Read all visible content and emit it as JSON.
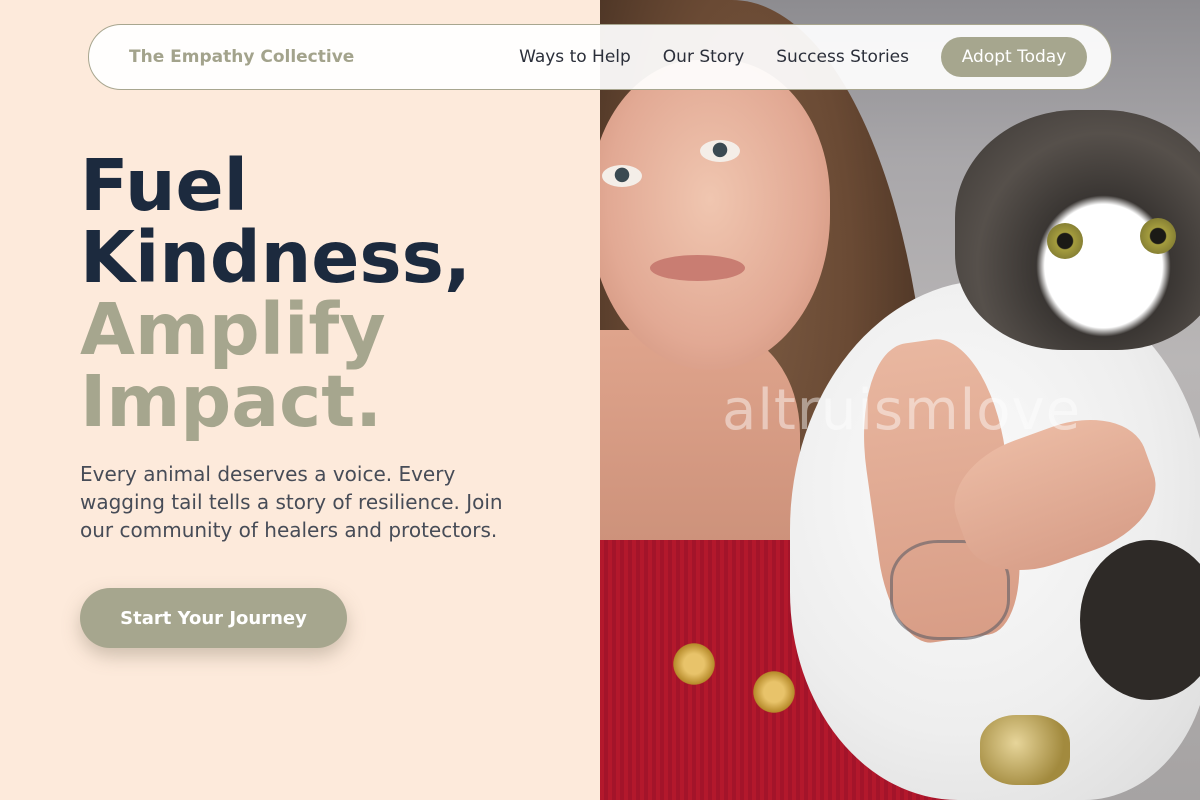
{
  "nav": {
    "brand": "The Empathy Collective",
    "links": [
      "Ways to Help",
      "Our Story",
      "Success Stories"
    ],
    "cta": "Adopt Today"
  },
  "hero": {
    "line1": "Fuel",
    "line2": "Kindness,",
    "line3": "Amplify",
    "line4": "Impact.",
    "subtitle": "Every animal deserves a voice. Every wagging tail tells a story of resilience. Join our community of healers and protectors.",
    "cta": "Start Your Journey"
  },
  "photo": {
    "watermark": "altruismlove"
  },
  "colors": {
    "background": "#fdeadb",
    "accent": "#a6a68e",
    "heading": "#1c2a3e"
  }
}
